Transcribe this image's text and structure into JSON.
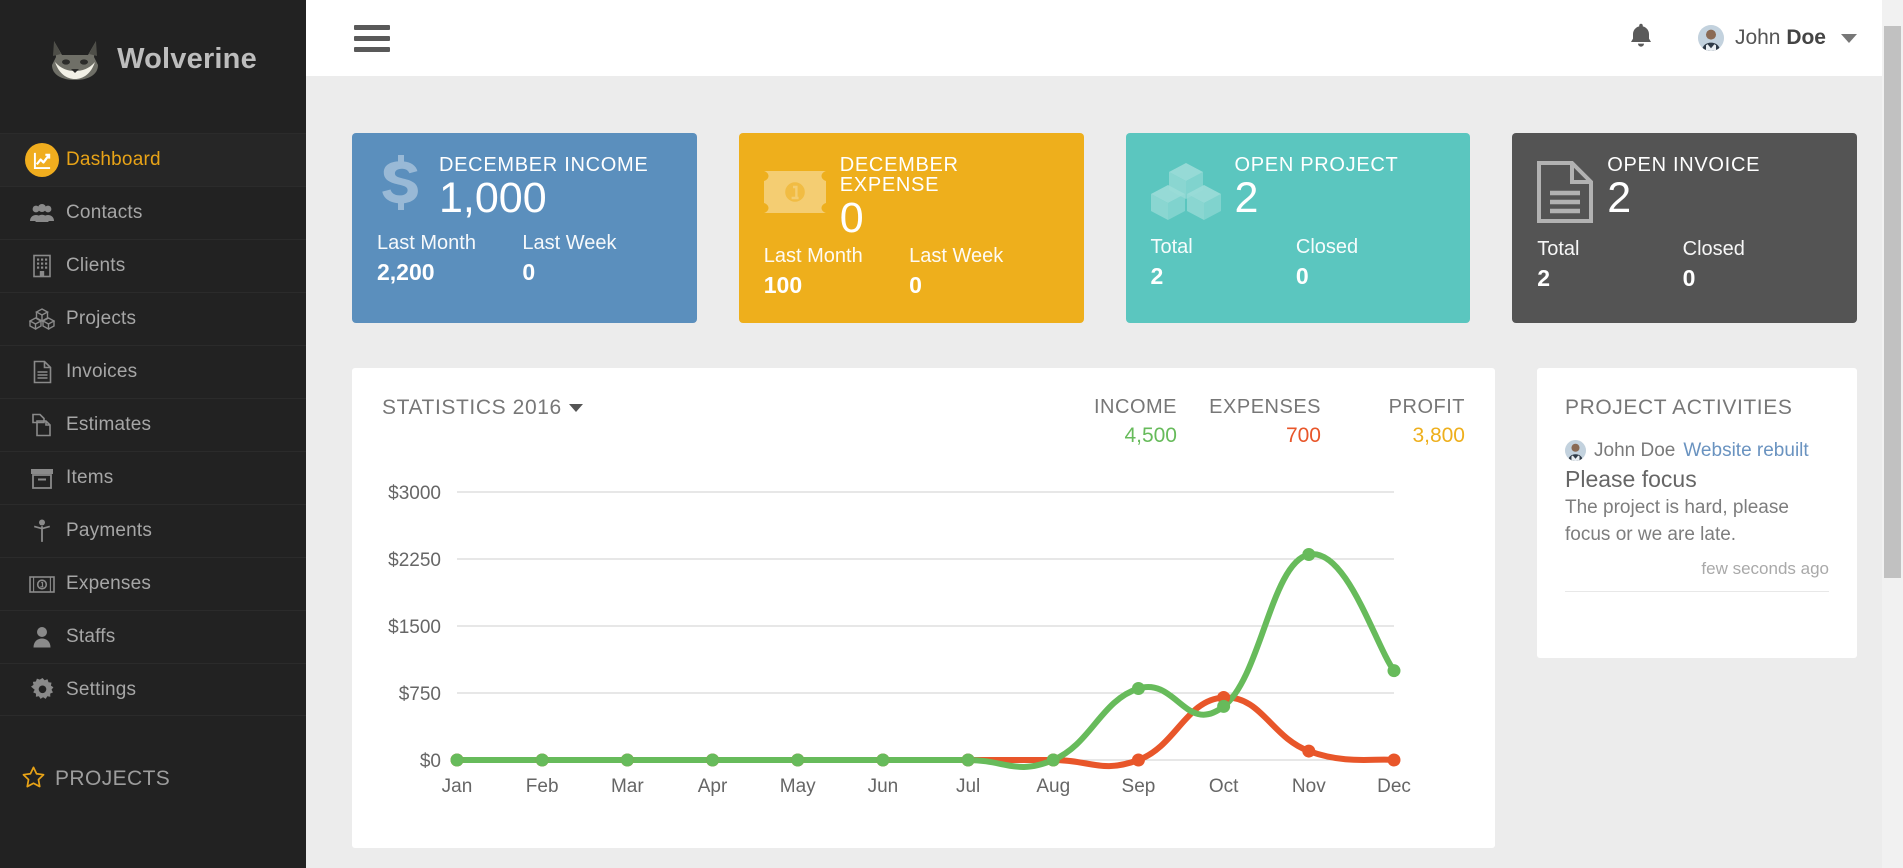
{
  "sidebar": {
    "brand": {
      "name": "Wolverine",
      "logo_icon": "wolf-head-icon"
    },
    "items": [
      {
        "label": "Dashboard",
        "icon": "line-chart-icon",
        "active": true
      },
      {
        "label": "Contacts",
        "icon": "users-icon",
        "active": false
      },
      {
        "label": "Clients",
        "icon": "building-icon",
        "active": false
      },
      {
        "label": "Projects",
        "icon": "cubes-icon",
        "active": false
      },
      {
        "label": "Invoices",
        "icon": "file-text-icon",
        "active": false
      },
      {
        "label": "Estimates",
        "icon": "files-icon",
        "active": false
      },
      {
        "label": "Items",
        "icon": "archive-icon",
        "active": false
      },
      {
        "label": "Payments",
        "icon": "person-icon",
        "active": false
      },
      {
        "label": "Expenses",
        "icon": "money-bill-icon",
        "active": false
      },
      {
        "label": "Staffs",
        "icon": "user-icon",
        "active": false
      },
      {
        "label": "Settings",
        "icon": "gear-icon",
        "active": false
      }
    ],
    "projects_section": {
      "label": "PROJECTS",
      "icon": "star-icon"
    }
  },
  "topbar": {
    "menu_icon": "hamburger-icon",
    "notification_icon": "bell-icon",
    "user": {
      "name_first": "John ",
      "name_last": "Doe",
      "avatar_icon": "avatar-icon",
      "caret_icon": "chevron-down-icon"
    }
  },
  "cards": [
    {
      "title": "DECEMBER INCOME",
      "value": "1,000",
      "icon": "dollar-sign-icon",
      "color": "#5b8fbd",
      "stats": [
        {
          "label": "Last Month",
          "value": "2,200"
        },
        {
          "label": "Last Week",
          "value": "0"
        }
      ]
    },
    {
      "title": "DECEMBER\nEXPENSE",
      "value": "0",
      "icon": "money-bill-icon",
      "color": "#eeaf1c",
      "stats": [
        {
          "label": "Last Month",
          "value": "100"
        },
        {
          "label": "Last Week",
          "value": "0"
        }
      ]
    },
    {
      "title": "OPEN PROJECT",
      "value": "2",
      "icon": "cubes-icon",
      "color": "#5bc6bf",
      "stats": [
        {
          "label": "Total",
          "value": "2"
        },
        {
          "label": "Closed",
          "value": "0"
        }
      ]
    },
    {
      "title": "OPEN INVOICE",
      "value": "2",
      "icon": "file-text-icon",
      "color": "#545454",
      "stats": [
        {
          "label": "Total",
          "value": "2"
        },
        {
          "label": "Closed",
          "value": "0"
        }
      ]
    }
  ],
  "statistics": {
    "title": "STATISTICS 2016",
    "caret_icon": "caret-down-icon",
    "legend": [
      {
        "label": "INCOME",
        "value": "4,500",
        "color": "#67bb5b"
      },
      {
        "label": "EXPENSES",
        "value": "700",
        "color": "#e8562a"
      },
      {
        "label": "PROFIT",
        "value": "3,800",
        "color": "#eeaf1c"
      }
    ]
  },
  "chart_data": {
    "type": "line",
    "title": "STATISTICS 2016",
    "xlabel": "",
    "ylabel": "",
    "grid": true,
    "legend_position": "top-right",
    "categories": [
      "Jan",
      "Feb",
      "Mar",
      "Apr",
      "May",
      "Jun",
      "Jul",
      "Aug",
      "Sep",
      "Oct",
      "Nov",
      "Dec"
    ],
    "ylim": [
      0,
      3000
    ],
    "yticks": [
      0,
      750,
      1500,
      2250,
      3000
    ],
    "ytick_labels": [
      "$0",
      "$750",
      "$1500",
      "$2250",
      "$3000"
    ],
    "series": [
      {
        "name": "INCOME",
        "color": "#67bb5b",
        "values": [
          0,
          0,
          0,
          0,
          0,
          0,
          0,
          0,
          800,
          600,
          2300,
          1000
        ]
      },
      {
        "name": "EXPENSES",
        "color": "#e8562a",
        "values": [
          0,
          0,
          0,
          0,
          0,
          0,
          0,
          0,
          0,
          700,
          100,
          0
        ]
      }
    ]
  },
  "activities": {
    "title": "PROJECT ACTIVITIES",
    "items": [
      {
        "user": "John Doe",
        "link": "Website rebuilt",
        "subject": "Please focus",
        "body": "The project is hard, please focus or we are late.",
        "time": "few seconds ago",
        "avatar_icon": "avatar-icon"
      }
    ]
  }
}
